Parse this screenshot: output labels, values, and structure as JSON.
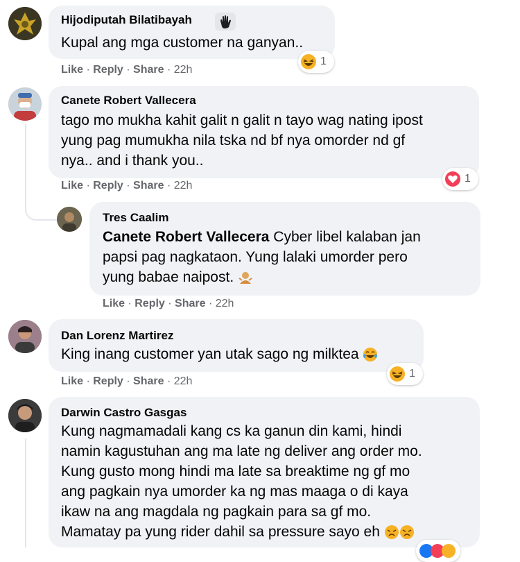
{
  "comments": [
    {
      "author": "Hijodiputah Bilatibayah",
      "lines": [
        "Kupal ang mga customer na ganyan.."
      ],
      "actions": {
        "like": "Like",
        "reply": "Reply",
        "share": "Share",
        "time": "22h"
      },
      "reaction": {
        "icon": "laughing-emoji-icon",
        "count": "1"
      }
    },
    {
      "author": "Canete Robert Vallecera",
      "lines": [
        "tago mo mukha kahit galit n galit n tayo wag nating ipost",
        "yung pag mumukha nila tska nd bf nya omorder nd gf",
        "nya.. and i thank you.."
      ],
      "actions": {
        "like": "Like",
        "reply": "Reply",
        "share": "Share",
        "time": "22h"
      },
      "reaction": {
        "icon": "heart-icon",
        "count": "1"
      }
    },
    {
      "author": "Tres Caalim",
      "mention": "Canete Robert Vallecera",
      "lines": [
        " Cyber libel kalaban jan",
        "papsi pag nagkataon. Yung lalaki umorder pero",
        "yung babae naipost."
      ],
      "actions": {
        "like": "Like",
        "reply": "Reply",
        "share": "Share",
        "time": "22h"
      }
    },
    {
      "author": "Dan Lorenz Martirez",
      "lines": [
        "King inang customer yan utak sago ng milktea"
      ],
      "actions": {
        "like": "Like",
        "reply": "Reply",
        "share": "Share",
        "time": "22h"
      },
      "reaction": {
        "icon": "laughing-emoji-icon",
        "count": "1"
      }
    },
    {
      "author": "Darwin Castro Gasgas",
      "lines": [
        "Kung nagmamadali kang cs ka ganun din kami, hindi",
        "namin kagustuhan ang ma late ng deliver ang order mo.",
        "Kung gusto mong hindi ma late sa breaktime ng gf mo",
        "ang pagkain nya umorder ka ng mas maaga o di kaya",
        "ikaw na ang magdala ng pagkain para sa gf mo.",
        "Mamatay pa yung rider dahil sa pressure sayo eh"
      ]
    }
  ],
  "colors": {
    "bubble": "#f0f2f5",
    "meta": "#65676b",
    "heart": "#f33e58",
    "emoji": "#f7b125"
  }
}
